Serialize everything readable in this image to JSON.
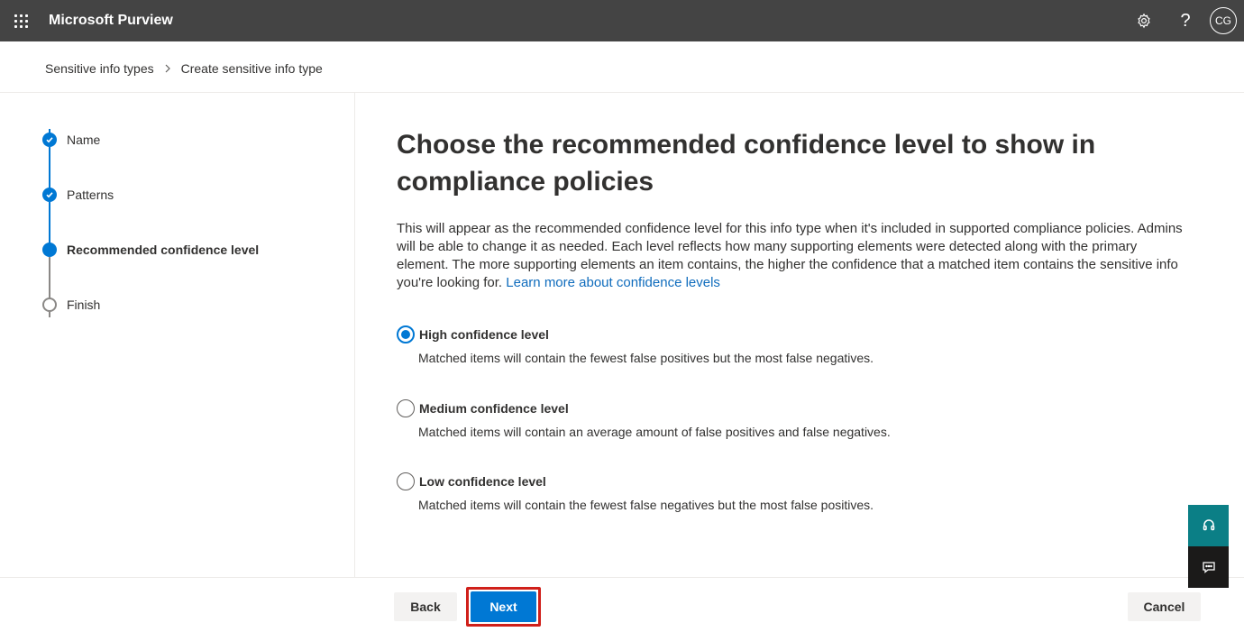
{
  "app": {
    "title": "Microsoft Purview"
  },
  "header": {
    "icons": [
      "app-launcher-icon",
      "gear-icon",
      "help-icon"
    ],
    "help_glyph": "?",
    "avatar_initials": "CG"
  },
  "breadcrumb": {
    "items": [
      "Sensitive info types",
      "Create sensitive info type"
    ]
  },
  "steps": [
    {
      "label": "Name",
      "status": "done"
    },
    {
      "label": "Patterns",
      "status": "done"
    },
    {
      "label": "Recommended confidence level",
      "status": "current"
    },
    {
      "label": "Finish",
      "status": "todo"
    }
  ],
  "main": {
    "heading": "Choose the recommended confidence level to show in compliance policies",
    "description": "This will appear as the recommended confidence level for this info type when it's included in supported compliance policies. Admins will be able to change it as needed. Each level reflects how many supporting elements were detected along with the primary element. The more supporting elements an item contains, the higher the confidence that a matched item contains the sensitive info you're looking for.",
    "learn_more_link": "Learn more about confidence levels",
    "options": [
      {
        "title": "High confidence level",
        "description": "Matched items will contain the fewest false positives but the most false negatives.",
        "selected": true
      },
      {
        "title": "Medium confidence level",
        "description": "Matched items will contain an average amount of false positives and false negatives.",
        "selected": false
      },
      {
        "title": "Low confidence level",
        "description": "Matched items will contain the fewest false negatives but the most false positives.",
        "selected": false
      }
    ]
  },
  "footer": {
    "back_label": "Back",
    "next_label": "Next",
    "cancel_label": "Cancel"
  },
  "colors": {
    "topbar": "#444444",
    "accent": "#0078d4",
    "highlight_outline": "#d0201a",
    "help_float": "#0b7f86",
    "feedback_float": "#1b1a19"
  },
  "floating": [
    "headset-icon",
    "feedback-icon"
  ]
}
